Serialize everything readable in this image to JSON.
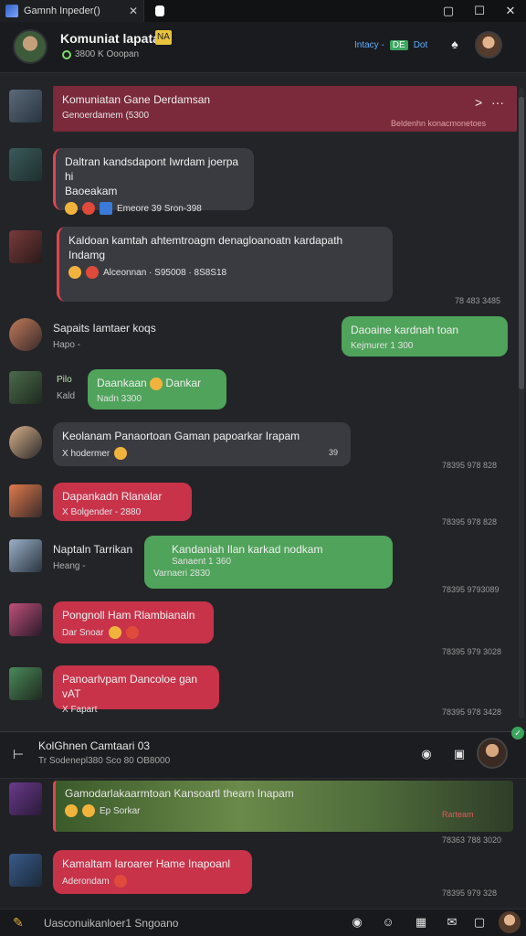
{
  "window": {
    "tab_title": "Gamnh Inpeder()",
    "tab_close": "✕",
    "controls": {
      "minimize": "▢",
      "maximize": "☐",
      "close": "✕"
    }
  },
  "header": {
    "title": "Komuniat lapata",
    "badge": "NA",
    "subtitle": "3800 K Ooopan",
    "status_a": "Intacy -",
    "status_b": "DE",
    "status_c": "Dot"
  },
  "pinned": {
    "title": "Komuniatan Gane Derdamsan",
    "meta": "Genoerdamem (5300",
    "right_meta": "Beldenhn konacmonetoes",
    "arrow": ">",
    "more": "···"
  },
  "messages": [
    {
      "title": "Daltran kandsdapont Iwrdam joerpa hi",
      "title2": "Baoeakam",
      "meta": "Emeore 39 Sron-398"
    },
    {
      "title": "Kaldoan kamtah ahtemtroagm denagloanoatn kardapath",
      "title2": "Indamg",
      "meta": "Alceonnan · S95008 · 8S8S18"
    },
    {
      "name": "Sapaits Iamtaer koqs",
      "sub": "Hapo -",
      "bubble": "Daoaine kardnah toan",
      "bubble_meta": "Kejmurer 1 300"
    },
    {
      "name": "Pilo",
      "sub": "Kald",
      "bubble": "Daankaan",
      "bubble_tail": "Dankar",
      "bubble_meta": "Nadn 3300"
    },
    {
      "title": "Keolanam Panaortoan Gaman papoarkar Irapam",
      "meta": "X hodermer",
      "right_meta": "39"
    },
    {
      "bubble": "Dapankadn Rlanalar",
      "bubble_meta": "X Bolgender - 2880"
    },
    {
      "name": "Naptaln Tarrikan",
      "sub": "Heang -",
      "bubble": "Kandaniah Ilan karkad nodkam",
      "bubble_meta1": "Sanaent 1 360",
      "bubble_meta2": "Varnaeri 2830"
    },
    {
      "bubble": "Pongnoll Ham Rlambianaln",
      "bubble_meta": "Dar Snoar"
    },
    {
      "bubble": "Panoarlvpam Dancoloe gan vAT",
      "bubble_meta": "X Fapart"
    }
  ],
  "timestamps": [
    "78 483 3485",
    "78395 978 828",
    "78395 978 828",
    "78395 9793089",
    "78395 979 3028",
    "78395 978 3428",
    "78395 978 3428"
  ],
  "thread": {
    "title": "KolGhnen Camtaari 03",
    "sub": "Tr Sodenepl380 Sco 80 OB8000",
    "lead": "⊢"
  },
  "lower": [
    {
      "title": "Gamodarlakaarmtoan Kansoartl thearn Inapam",
      "meta": "Ep Sorkar",
      "right_meta": "Rarteam"
    },
    {
      "title": "Kamaltam Iaroarer Hame Inapoanl",
      "meta": "Aderondam"
    }
  ],
  "lower_timestamps": [
    "78363 788 3020",
    "78395 979 328"
  ],
  "input": {
    "placeholder": "Uasconuikanloer1 Sngoano"
  },
  "colors": {
    "red": "#c8334a",
    "green": "#4fa35a",
    "dark": "#3a3b40",
    "pinned": "#7a2a3a"
  }
}
